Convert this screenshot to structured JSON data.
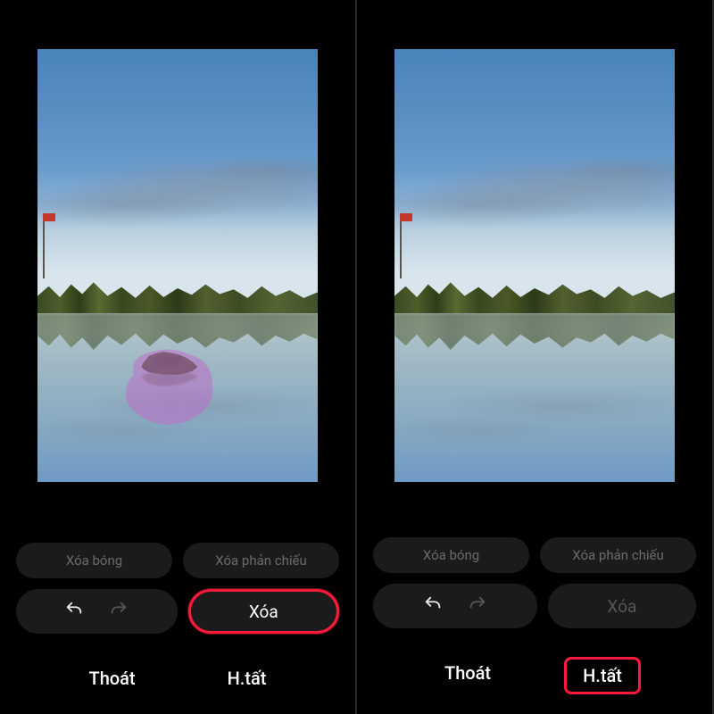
{
  "panels": [
    {
      "has_island": true,
      "has_selection_overlay": true,
      "erase_enabled": true,
      "erase_highlighted": true,
      "done_highlighted": false
    },
    {
      "has_island": false,
      "has_selection_overlay": false,
      "erase_enabled": false,
      "erase_highlighted": false,
      "done_highlighted": true
    }
  ],
  "buttons": {
    "remove_shadow": "Xóa bóng",
    "remove_reflection": "Xóa phản chiếu",
    "erase": "Xóa",
    "exit": "Thoát",
    "done": "H.tất"
  },
  "icons": {
    "undo": "undo-icon",
    "redo": "redo-icon"
  },
  "highlight_color": "#ff1a3c",
  "selection_overlay_color": "rgba(190,110,200,0.55)"
}
